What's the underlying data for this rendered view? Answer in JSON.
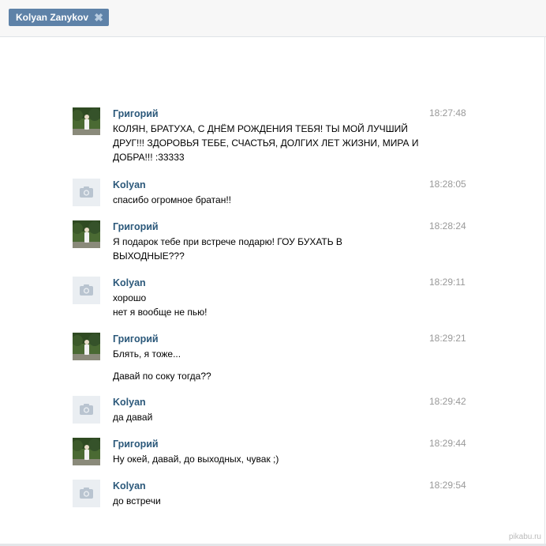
{
  "tab": {
    "title": "Kolyan Zanykov",
    "close": "✖"
  },
  "watermark": "pikabu.ru",
  "messages": [
    {
      "author": "Григорий",
      "time": "18:27:48",
      "avatar": "photo",
      "lines": [
        "КОЛЯН, БРАТУХА, С ДНЁМ РОЖДЕНИЯ ТЕБЯ! ТЫ МОЙ ЛУЧШИЙ",
        "ДРУГ!!! ЗДОРОВЬЯ ТЕБЕ, СЧАСТЬЯ, ДОЛГИХ ЛЕТ ЖИЗНИ, МИРА И",
        "ДОБРА!!! :33333"
      ]
    },
    {
      "author": "Kolyan",
      "time": "18:28:05",
      "avatar": "camera",
      "lines": [
        "спасибо огромное братан!!"
      ]
    },
    {
      "author": "Григорий",
      "time": "18:28:24",
      "avatar": "photo",
      "lines": [
        "Я подарок тебе при встрече подарю! ГОУ БУХАТЬ В",
        "ВЫХОДНЫЕ???"
      ]
    },
    {
      "author": "Kolyan",
      "time": "18:29:11",
      "avatar": "camera",
      "lines": [
        "хорошо",
        "нет я вообще не пью!"
      ]
    },
    {
      "author": "Григорий",
      "time": "18:29:21",
      "avatar": "photo",
      "lines": [
        "Блять, я тоже...",
        "Давай по соку тогда??"
      ]
    },
    {
      "author": "Kolyan",
      "time": "18:29:42",
      "avatar": "camera",
      "lines": [
        "да давай"
      ]
    },
    {
      "author": "Григорий",
      "time": "18:29:44",
      "avatar": "photo",
      "lines": [
        "Ну окей, давай, до выходных, чувак ;)"
      ]
    },
    {
      "author": "Kolyan",
      "time": "18:29:54",
      "avatar": "camera",
      "lines": [
        "до встречи"
      ]
    }
  ]
}
